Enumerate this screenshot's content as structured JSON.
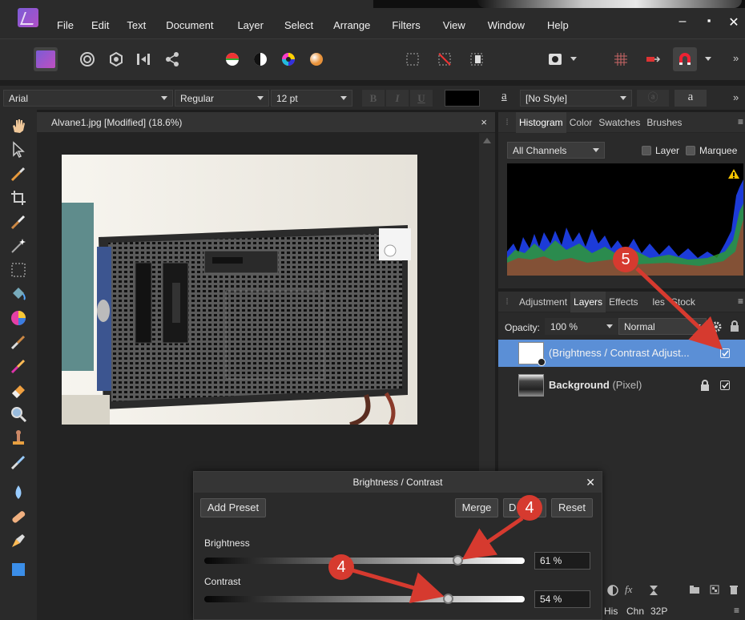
{
  "menu": [
    "File",
    "Edit",
    "Text",
    "Document",
    "Layer",
    "Select",
    "Arrange",
    "Filters",
    "View",
    "Window",
    "Help"
  ],
  "window_controls": {
    "minimize": "‒",
    "maximize": "▪",
    "close": "✕"
  },
  "context_bar": {
    "font_family": "Arial",
    "font_style": "Regular",
    "font_size": "12 pt",
    "bold": "B",
    "italic": "I",
    "underline": "U",
    "text_style_glyph": "a",
    "text_style": "[No Style]",
    "char_glyph": "a",
    "more": "»"
  },
  "toolbar": {
    "more": "»"
  },
  "document": {
    "title": "Alvane1.jpg [Modified] (18.6%)",
    "close": "×"
  },
  "histogram_panel": {
    "tabs": [
      "Histogram",
      "Color",
      "Swatches",
      "Brushes"
    ],
    "active_tab": "Histogram",
    "channels": "All Channels",
    "layer_checkbox_label": "Layer",
    "marquee_checkbox_label": "Marquee",
    "menu_glyph": "≡"
  },
  "layers_panel": {
    "tabs": [
      "Adjustment",
      "Layers",
      "Effects",
      "Styles",
      "Stock"
    ],
    "visible_tabs": [
      "Adjustment",
      "Layers",
      "Effects",
      "les",
      "Stock"
    ],
    "active_tab": "Layers",
    "opacity_label": "Opacity:",
    "opacity_value": "100 %",
    "blend_mode": "Normal",
    "menu_glyph": "≡",
    "layers": [
      {
        "name": "(Brightness / Contrast Adjust...",
        "kind": "",
        "selected": true,
        "visible": true
      },
      {
        "name": "Background",
        "kind": "(Pixel)",
        "selected": false,
        "visible": true,
        "locked": true
      }
    ],
    "bottom_glyph_fx": "fx"
  },
  "dialog": {
    "title": "Brightness / Contrast",
    "close": "✕",
    "add_preset": "Add Preset",
    "merge": "Merge",
    "delete_partial": "D",
    "reset": "Reset",
    "brightness_label": "Brightness",
    "brightness_value": "61 %",
    "brightness_level": 0.61,
    "contrast_label": "Contrast",
    "contrast_value": "54 %",
    "contrast_level": 0.54
  },
  "status": {
    "his": "His",
    "chn": "Chn",
    "bits": "32P",
    "menu": "≡"
  },
  "annotations": {
    "badge_layers": "5",
    "badge_brightness": "4",
    "badge_contrast": "4",
    "arrow_color": "#d63a2f"
  },
  "colors": {
    "accent_selection": "#5b8fd6",
    "app_brand": "#8a58d0"
  }
}
